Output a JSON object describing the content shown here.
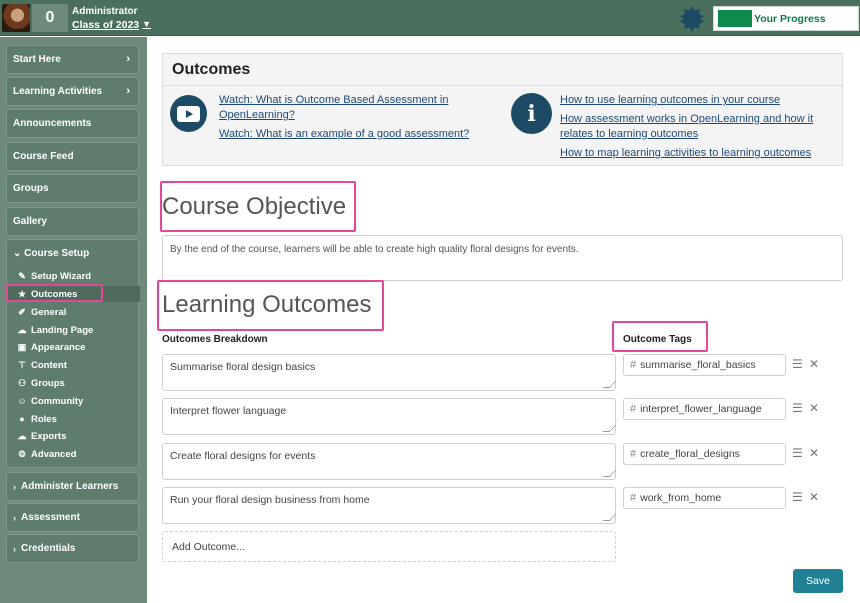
{
  "topbar": {
    "count": "0",
    "role": "Administrator",
    "class_name": "Class of 2023",
    "progress_label": "Your Progress"
  },
  "sidebar": {
    "items": [
      {
        "label": "Start Here",
        "arrow": "›"
      },
      {
        "label": "Learning Activities",
        "arrow": "›"
      },
      {
        "label": "Announcements"
      },
      {
        "label": "Course Feed"
      },
      {
        "label": "Groups"
      },
      {
        "label": "Gallery"
      }
    ],
    "setup": {
      "heading": "Course Setup",
      "items": [
        {
          "label": "Setup Wizard",
          "icon": "pencil-icon"
        },
        {
          "label": "Outcomes",
          "icon": "star-icon"
        },
        {
          "label": "General",
          "icon": "edit-icon"
        },
        {
          "label": "Landing Page",
          "icon": "cloud-icon"
        },
        {
          "label": "Appearance",
          "icon": "image-icon"
        },
        {
          "label": "Content",
          "icon": "sitemap-icon"
        },
        {
          "label": "Groups",
          "icon": "users-icon"
        },
        {
          "label": "Community",
          "icon": "smile-icon"
        },
        {
          "label": "Roles",
          "icon": "user-icon"
        },
        {
          "label": "Exports",
          "icon": "cloud-download-icon"
        },
        {
          "label": "Advanced",
          "icon": "cogs-icon"
        }
      ]
    },
    "bottom_items": [
      {
        "label": "Administer Learners"
      },
      {
        "label": "Assessment"
      },
      {
        "label": "Credentials"
      }
    ]
  },
  "info": {
    "title": "Outcomes",
    "video_links": [
      "Watch: What is Outcome Based Assessment in OpenLearning?",
      "Watch: What is an example of a good assessment?"
    ],
    "help_links": [
      "How to use learning outcomes in your course",
      "How assessment works in OpenLearning and how it relates to learning outcomes",
      "How to map learning activities to learning outcomes"
    ]
  },
  "objective": {
    "title": "Course Objective",
    "text": "By the end of the course, learners will be able to create high quality floral designs for events."
  },
  "learning_outcomes": {
    "title": "Learning Outcomes",
    "breakdown_header": "Outcomes Breakdown",
    "tags_header": "Outcome Tags",
    "rows": [
      {
        "text": "Summarise floral design basics",
        "tag": "summarise_floral_basics"
      },
      {
        "text": "Interpret flower language",
        "tag": "interpret_flower_language"
      },
      {
        "text": "Create floral designs for events",
        "tag": "create_floral_designs"
      },
      {
        "text": "Run your floral design business from home",
        "tag": "work_from_home"
      }
    ],
    "add_label": "Add Outcome..."
  },
  "save_label": "Save",
  "colors": {
    "topbar": "#4b6f5d",
    "sidebar": "#6d8a7b",
    "highlight": "#e2479a",
    "save": "#1f8193",
    "progress": "#0e8a4c"
  }
}
